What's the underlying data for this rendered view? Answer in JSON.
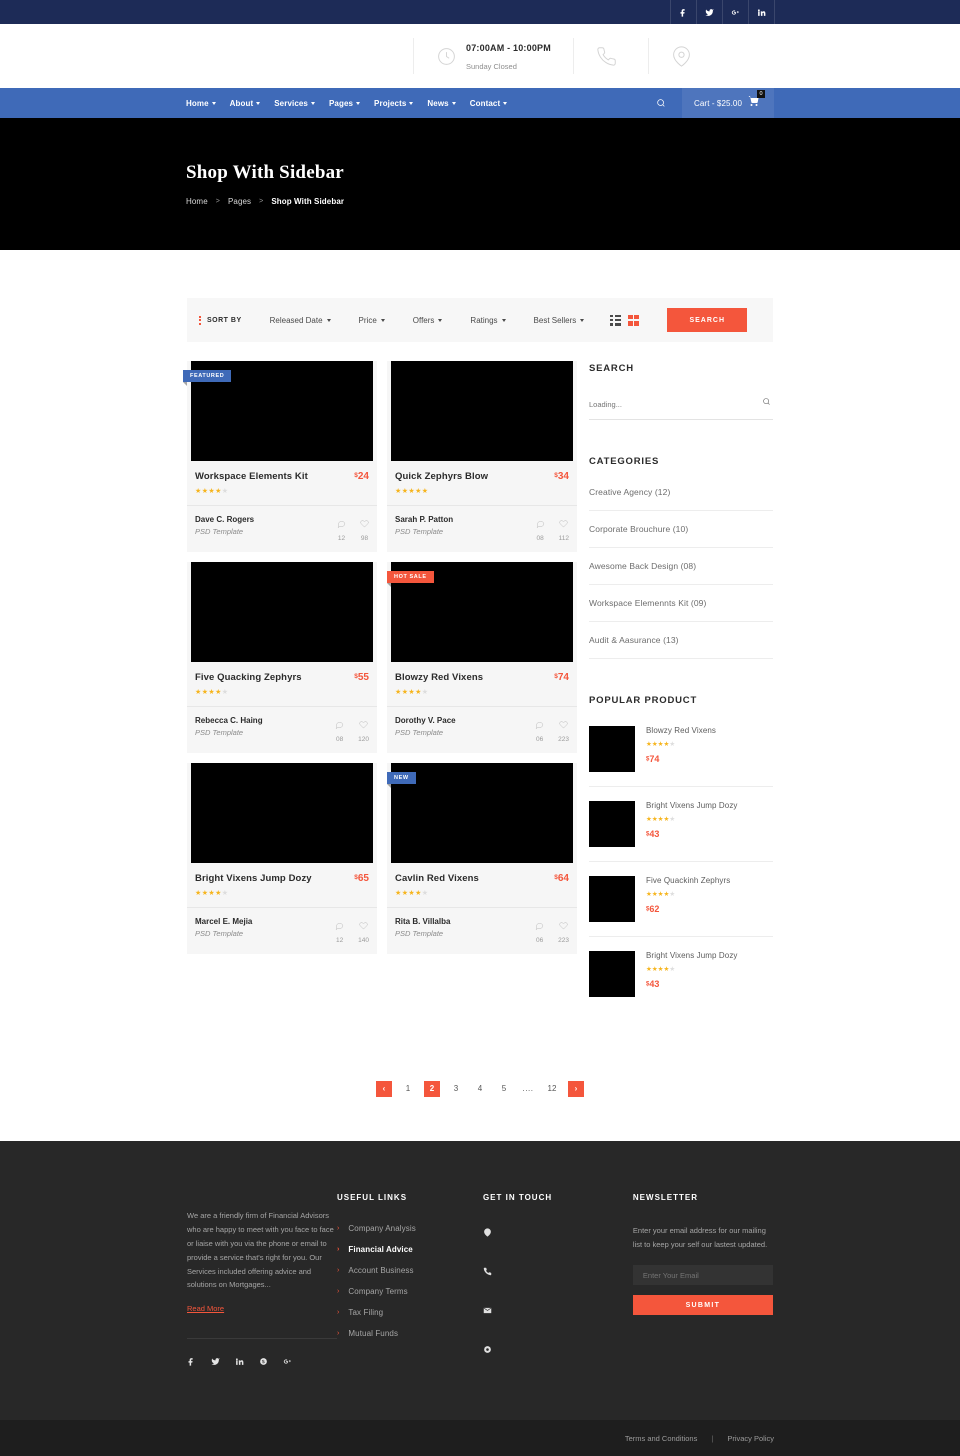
{
  "topbar": {
    "social": [
      {
        "name": "facebook-icon",
        "label": "f"
      },
      {
        "name": "twitter-icon",
        "label": "t"
      },
      {
        "name": "google-plus-icon",
        "label": "G+"
      },
      {
        "name": "linkedin-icon",
        "label": "in"
      }
    ]
  },
  "infobar": {
    "hours_main": "07:00AM - 10:00PM",
    "hours_sub": "Sunday Closed",
    "phone_main": "",
    "phone_sub": "",
    "location_main": "",
    "location_sub": ""
  },
  "nav": {
    "items": [
      {
        "label": "Home",
        "dropdown": true
      },
      {
        "label": "About",
        "dropdown": true
      },
      {
        "label": "Services",
        "dropdown": true
      },
      {
        "label": "Pages",
        "dropdown": true
      },
      {
        "label": "Projects",
        "dropdown": true
      },
      {
        "label": "News",
        "dropdown": true
      },
      {
        "label": "Contact",
        "dropdown": true
      }
    ],
    "cart_label": "Cart - $25.00",
    "cart_badge": "0"
  },
  "hero": {
    "title": "Shop With Sidebar",
    "breadcrumb": [
      "Home",
      "Pages",
      "Shop With Sidebar"
    ]
  },
  "sortbar": {
    "sort_by": "SORT BY",
    "options": [
      "Released Date",
      "Price",
      "Offers",
      "Ratings",
      "Best Sellers"
    ],
    "search_label": "SEARCH"
  },
  "products": [
    {
      "title": "Workspace Elements Kit",
      "price": "24",
      "currency": "$",
      "stars": 4,
      "badge": "FEATURED",
      "badge_type": "featured",
      "author": "Dave C. Rogers",
      "author_sub": "PSD Template",
      "comments": "12",
      "likes": "98"
    },
    {
      "title": "Quick Zephyrs Blow",
      "price": "34",
      "currency": "$",
      "stars": 5,
      "badge": "",
      "badge_type": "",
      "author": "Sarah P. Patton",
      "author_sub": "PSD Template",
      "comments": "08",
      "likes": "112"
    },
    {
      "title": "Five Quacking Zephyrs",
      "price": "55",
      "currency": "$",
      "stars": 4,
      "badge": "",
      "badge_type": "",
      "author": "Rebecca C. Haing",
      "author_sub": "PSD Template",
      "comments": "08",
      "likes": "120"
    },
    {
      "title": "Blowzy Red Vixens",
      "price": "74",
      "currency": "$",
      "stars": 4,
      "badge": "HOT SALE",
      "badge_type": "hot",
      "author": "Dorothy V. Pace",
      "author_sub": "PSD Template",
      "comments": "06",
      "likes": "223"
    },
    {
      "title": "Bright Vixens Jump Dozy",
      "price": "65",
      "currency": "$",
      "stars": 4,
      "badge": "",
      "badge_type": "",
      "author": "Marcel E. Mejia",
      "author_sub": "PSD Template",
      "comments": "12",
      "likes": "140"
    },
    {
      "title": "Cavlin Red Vixens",
      "price": "64",
      "currency": "$",
      "stars": 4,
      "badge": "NEW",
      "badge_type": "new",
      "author": "Rita B. Villalba",
      "author_sub": "PSD Template",
      "comments": "06",
      "likes": "223"
    }
  ],
  "sidebar": {
    "search_title": "SEARCH",
    "search_placeholder": "Loading...",
    "search_value": "",
    "categories_title": "CATEGORIES",
    "categories": [
      "Creative Agency (12)",
      "Corporate Brouchure (10)",
      "Awesome Back Design (08)",
      "Workspace Elemennts Kit (09)",
      "Audit & Aasurance (13)"
    ],
    "popular_title": "POPULAR PRODUCT",
    "popular": [
      {
        "name": "Blowzy Red Vixens",
        "stars": 4,
        "price": "74",
        "currency": "$"
      },
      {
        "name": "Bright Vixens Jump Dozy",
        "stars": 4,
        "price": "43",
        "currency": "$"
      },
      {
        "name": "Five Quackinh Zephyrs",
        "stars": 4,
        "price": "62",
        "currency": "$"
      },
      {
        "name": "Bright Vixens Jump Dozy",
        "stars": 4,
        "price": "43",
        "currency": "$"
      }
    ]
  },
  "pagination": {
    "prev": "‹",
    "next": "›",
    "pages": [
      "1",
      "2",
      "3",
      "4",
      "5",
      "....",
      "12"
    ],
    "active": "2"
  },
  "footer": {
    "about_text": "We are a friendly firm of Financial Advisors who are happy to meet with you face to face or liaise with you via the phone or email to provide a service that's right for you. Our Services included offering advice and solutions on Mortgages...",
    "read_more": "Read More",
    "social": [
      {
        "name": "facebook-icon",
        "label": "f"
      },
      {
        "name": "twitter-icon",
        "label": "t"
      },
      {
        "name": "linkedin-icon",
        "label": "in"
      },
      {
        "name": "skype-icon",
        "label": "S"
      },
      {
        "name": "google-plus-icon",
        "label": "G+"
      }
    ],
    "links_title": "USEFUL LINKS",
    "links": [
      {
        "label": "Company Analysis",
        "active": false
      },
      {
        "label": "Financial Advice",
        "active": true
      },
      {
        "label": "Account Business",
        "active": false
      },
      {
        "label": "Company Terms",
        "active": false
      },
      {
        "label": "Tax Filing",
        "active": false
      },
      {
        "label": "Mutual Funds",
        "active": false
      }
    ],
    "touch_title": "GET IN TOUCH",
    "touch": [
      {
        "icon": "location-icon",
        "text": ""
      },
      {
        "icon": "phone-icon",
        "text": ""
      },
      {
        "icon": "email-icon",
        "text": ""
      },
      {
        "icon": "clock-icon",
        "text": ""
      }
    ],
    "news_title": "NEWSLETTER",
    "news_text": "Enter your email address for our mailing list to keep your self our lastest updated.",
    "news_placeholder": "Enter Your Email",
    "news_value": "",
    "submit_label": "SUBMIT",
    "bottom_terms": "Terms and Conditions",
    "bottom_sep": "|",
    "bottom_privacy": "Privacy Policy"
  },
  "colors": {
    "accent": "#f4563c",
    "brand_blue": "#3f6ab8",
    "navy": "#1d2b57",
    "star": "#f6b51e",
    "footer_bg": "#282828"
  }
}
